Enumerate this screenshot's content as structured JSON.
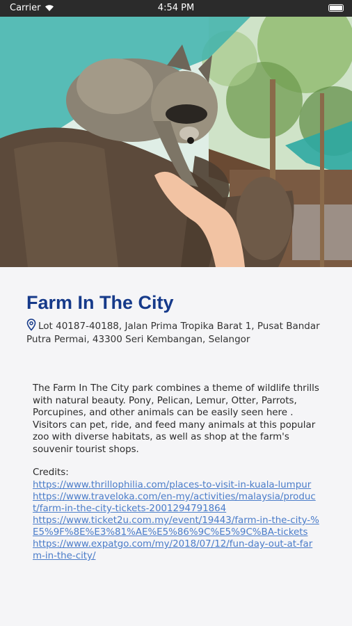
{
  "status_bar": {
    "carrier": "Carrier",
    "time": "4:54 PM"
  },
  "hero": {
    "icon": "photo"
  },
  "place": {
    "title": "Farm In The City",
    "address": "Lot 40187-40188, Jalan Prima Tropika Barat 1, Pusat Bandar Putra Permai, 43300 Seri Kembangan, Selangor",
    "description": "The Farm In The City park combines a theme of wildlife thrills with natural beauty. Pony, Pelican, Lemur, Otter, Parrots, Porcupines, and other animals can be easily seen here . Visitors can pet, ride, and feed many animals at this popular zoo with diverse habitats, as well as shop at the farm's souvenir tourist shops.",
    "credits_label": "Credits:",
    "credits": [
      "https://www.thrillophilia.com/places-to-visit-in-kuala-lumpur",
      "https://www.traveloka.com/en-my/activities/malaysia/product/farm-in-the-city-tickets-2001294791864",
      "https://www.ticket2u.com.my/event/19443/farm-in-the-city-%E5%9F%8E%E3%81%AE%E5%86%9C%E5%9C%BA-tickets",
      "https://www.expatgo.com/my/2018/07/12/fun-day-out-at-farm-in-the-city/"
    ]
  },
  "colors": {
    "title": "#163a8a",
    "link": "#4a7cc9",
    "background": "#f5f5f7"
  }
}
